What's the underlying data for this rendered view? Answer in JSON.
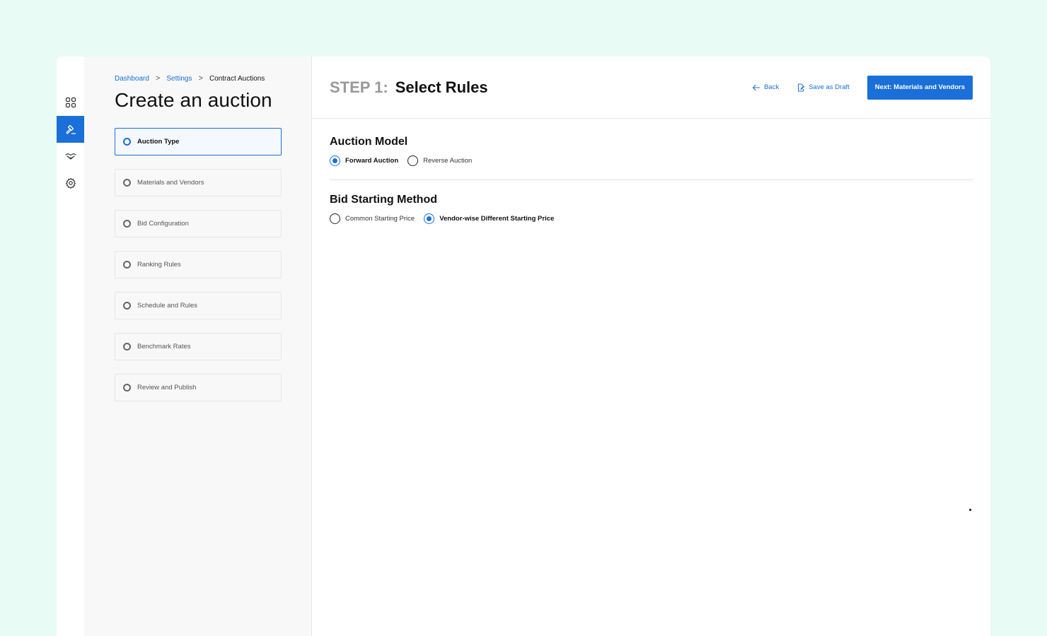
{
  "breadcrumb": {
    "items": [
      "Dashboard",
      "Settings"
    ],
    "current": "Contract Auctions",
    "separator": ">"
  },
  "page_title": "Create an auction",
  "rail": {
    "icons": [
      "grid-icon",
      "gavel-icon",
      "handshake-icon",
      "gear-icon"
    ],
    "active": "gavel-icon"
  },
  "steps": [
    {
      "label": "Auction Type",
      "active": true
    },
    {
      "label": "Materials and Vendors",
      "active": false
    },
    {
      "label": "Bid Configuration",
      "active": false
    },
    {
      "label": "Ranking Rules",
      "active": false
    },
    {
      "label": "Schedule and Rules",
      "active": false
    },
    {
      "label": "Benchmark Rates",
      "active": false
    },
    {
      "label": "Review and Publish",
      "active": false
    }
  ],
  "header": {
    "step_prefix": "STEP 1:",
    "step_name": "Select Rules",
    "back_label": "Back",
    "save_draft_label": "Save as Draft",
    "next_label": "Next: Materials and Vendors"
  },
  "auction_model": {
    "title": "Auction Model",
    "options": [
      {
        "label": "Forward Auction",
        "checked": true
      },
      {
        "label": "Reverse Auction",
        "checked": false
      }
    ]
  },
  "bid_starting_method": {
    "title": "Bid Starting Method",
    "options": [
      {
        "label": "Common Starting Price",
        "checked": false
      },
      {
        "label": "Vendor-wise Different Starting Price",
        "checked": true
      }
    ]
  },
  "colors": {
    "accent": "#1a6fd8",
    "page_background": "#e8fbf4",
    "panel_background": "#f8f8f8"
  }
}
